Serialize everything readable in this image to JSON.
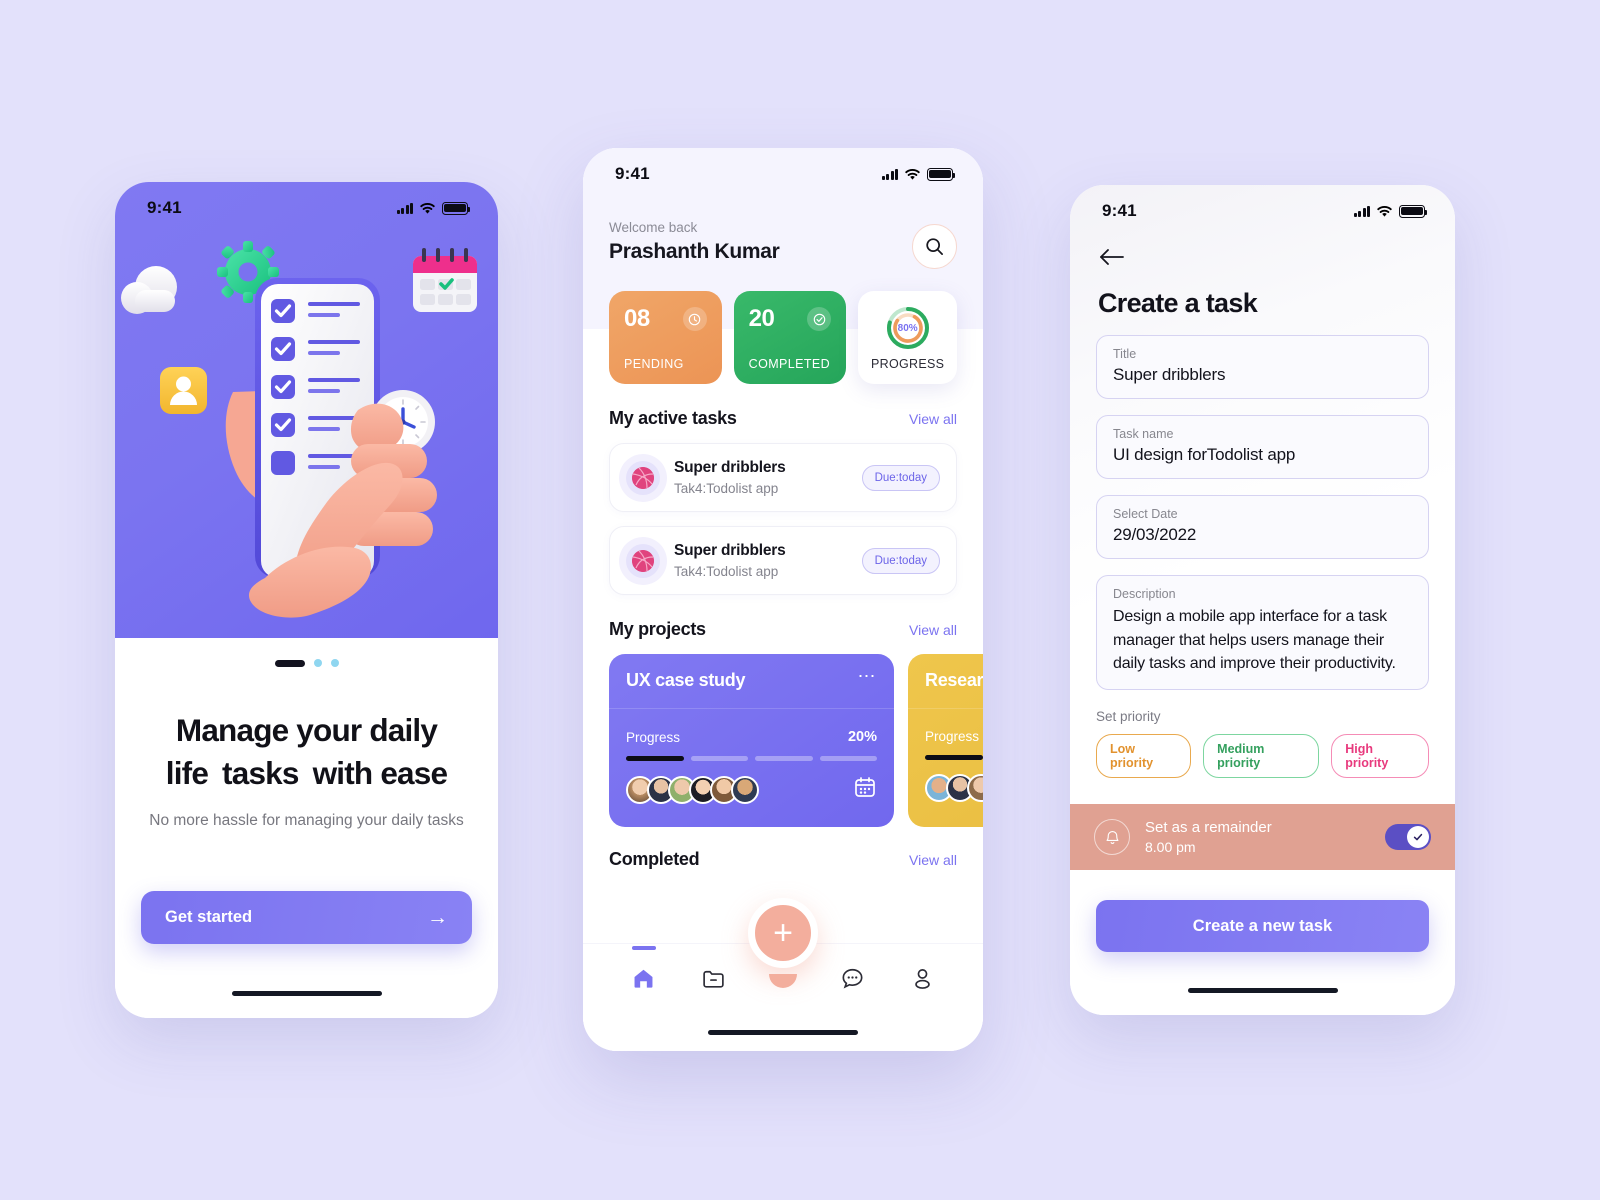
{
  "canvas": {
    "background": "#E3E1FB"
  },
  "onboarding": {
    "status_bar": {
      "time": "9:41",
      "signal_icon": "cellular-signal-icon",
      "wifi_icon": "wifi-icon",
      "battery_icon": "battery-full-icon"
    },
    "hero_alt": "3d-illustration-hand-holding-phone-checklist",
    "pagination": {
      "active_index": 0,
      "count": 3
    },
    "title_parts": {
      "line1": "Manage your daily",
      "line2_pre": "life",
      "line2_hl": "tasks",
      "line2_post": "with ease"
    },
    "subtitle": "No more hassle for managing your daily tasks",
    "cta": {
      "label": "Get started",
      "arrow": "→"
    }
  },
  "home": {
    "status_bar": {
      "time": "9:41"
    },
    "welcome_small": "Welcome back",
    "user_name": "Prashanth Kumar",
    "search_placeholder": "Search",
    "stats": [
      {
        "value": "08",
        "label": "PENDING",
        "color": "#EE9B5C",
        "icon": "clock-icon"
      },
      {
        "value": "20",
        "label": "COMPLETED",
        "color": "#2CAB5F",
        "icon": "check-circle-icon"
      },
      {
        "value": "80%",
        "label": "PROGRESS",
        "color": "#FFFFFF",
        "icon": "progress-ring-icon",
        "percent": 80
      }
    ],
    "active_tasks": {
      "heading": "My active tasks",
      "view_all": "View all",
      "items": [
        {
          "title": "Super dribblers",
          "subtitle": "Tak4:Todolist app",
          "due": "Due:today",
          "icon": "dribbble-icon"
        },
        {
          "title": "Super dribblers",
          "subtitle": "Tak4:Todolist app",
          "due": "Due:today",
          "icon": "dribbble-icon"
        }
      ]
    },
    "projects": {
      "heading": "My projects",
      "view_all": "View all",
      "items": [
        {
          "name": "UX case study",
          "progress_label": "Progress",
          "progress_value": "20%",
          "percent": 20,
          "segments": 4,
          "segments_on": 1,
          "members": 6,
          "color": "#7B73F0",
          "menu_icon": "more-horizontal-icon",
          "calendar_icon": "calendar-icon"
        },
        {
          "name": "Research",
          "progress_label": "Progress",
          "progress_value": "",
          "percent": 20,
          "segments": 4,
          "segments_on": 1,
          "members": 3,
          "color": "#EBC043",
          "menu_icon": "more-horizontal-icon",
          "calendar_icon": "calendar-icon"
        }
      ]
    },
    "completed": {
      "heading": "Completed",
      "view_all": "View all"
    },
    "tabbar": {
      "items": [
        {
          "name": "home",
          "icon": "home-icon",
          "active": true
        },
        {
          "name": "folder",
          "icon": "folder-minus-icon",
          "active": false
        },
        {
          "name": "chat",
          "icon": "chat-bubble-dots-icon",
          "active": false
        },
        {
          "name": "profile",
          "icon": "user-icon",
          "active": false
        }
      ],
      "fab": {
        "icon": "plus-icon",
        "label": "+"
      }
    }
  },
  "create_task": {
    "status_bar": {
      "time": "9:41"
    },
    "back_icon": "arrow-left-icon",
    "title": "Create a task",
    "fields": [
      {
        "label": "Title",
        "value": "Super dribblers"
      },
      {
        "label": "Task name",
        "value": "UI design forTodolist app"
      },
      {
        "label": "Select Date",
        "value": "29/03/2022"
      }
    ],
    "description": {
      "label": "Description",
      "value": "Design a mobile app interface for a task manager that helps users manage their daily tasks and improve their productivity."
    },
    "priority": {
      "label": "Set priority",
      "options": [
        {
          "label": "Low priority",
          "color": "#E2922E"
        },
        {
          "label": "Medium priority",
          "color": "#34A05E"
        },
        {
          "label": "High priority",
          "color": "#E8397D"
        }
      ]
    },
    "reminder": {
      "icon": "bell-icon",
      "title": "Set as a remainder",
      "time": "8.00 pm",
      "enabled": true,
      "toggle_icon": "check-icon"
    },
    "cta": {
      "label": "Create a new task"
    }
  }
}
